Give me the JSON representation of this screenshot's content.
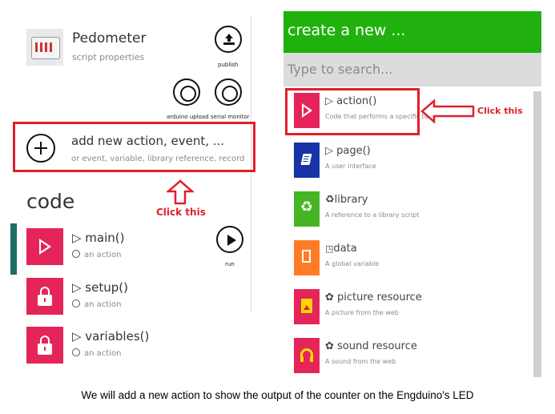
{
  "left": {
    "script": {
      "title": "Pedometer",
      "subtitle": "script properties"
    },
    "buttons": {
      "publish": "publish",
      "arduino_upload": "arduino upload",
      "serial_monitor": "serial monitor",
      "run": "run"
    },
    "add": {
      "title": "add new action, event, ...",
      "subtitle": "or event, variable, library reference, record"
    },
    "code_heading": "code",
    "annotation": "Click this",
    "items": [
      {
        "name": "▷ main()",
        "meta": "an action"
      },
      {
        "name": "▷ setup()",
        "meta": "an action"
      },
      {
        "name": "▷ variables()",
        "meta": "an action"
      }
    ]
  },
  "right": {
    "header_title": "create a new ...",
    "search_placeholder": "Type to search...",
    "annotation": "Click this",
    "items": [
      {
        "name": "▷ action()",
        "desc": "Code that performs a specific task",
        "color": "#e5245a"
      },
      {
        "name": "▷ page()",
        "desc": "A user interface",
        "color": "#1833a8"
      },
      {
        "name": "♻library",
        "desc": "A reference to a library script",
        "color": "#47b523"
      },
      {
        "name": "data",
        "desc": "A global variable",
        "color": "#ff7b27"
      },
      {
        "name": "✿ picture resource",
        "desc": "A picture from the web",
        "color": "#e5245a"
      },
      {
        "name": "✿ sound resource",
        "desc": "A sound from the web",
        "color": "#e5245a"
      }
    ]
  },
  "caption": "We will add a new action to show the output of the counter on the Engduino's LED",
  "colors": {
    "accent_red": "#e0202a",
    "header_green": "#20b10e",
    "tile_pink": "#e5245a",
    "selection_teal": "#1b6f64"
  }
}
